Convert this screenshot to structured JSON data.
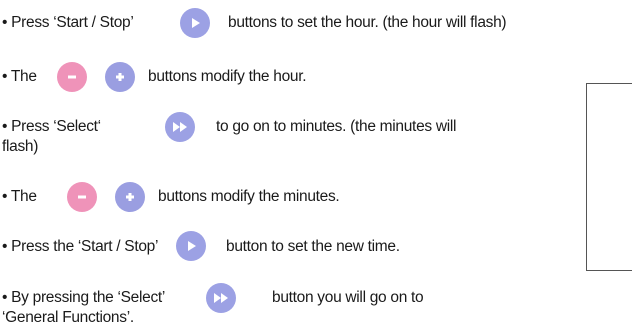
{
  "instructions": [
    {
      "before": "• Press ‘Start / Stop’",
      "after": "buttons to set the hour. (the hour will flash)"
    },
    {
      "before": "• The",
      "after": "buttons modify the hour."
    },
    {
      "before": "• Press ‘Select‘",
      "after": "to go on to minutes. (the minutes will",
      "cont": "flash)"
    },
    {
      "before": "• The",
      "after": "buttons modify the minutes."
    },
    {
      "before": "• Press the ‘Start / Stop’",
      "after": "button to set the new time."
    },
    {
      "before": "• By pressing the ‘Select’",
      "after": "button you will go on to",
      "cont": "‘General Functions’."
    }
  ],
  "icons": {
    "start_stop": "play-icon",
    "minus": "minus-icon",
    "plus": "plus-icon",
    "select": "fast-forward-icon"
  },
  "colors": {
    "minus_button": "#ef93b9",
    "plus_button": "#9a9ee1",
    "start_stop_button": "#9ca1e4",
    "select_button": "#9ca1e4"
  }
}
